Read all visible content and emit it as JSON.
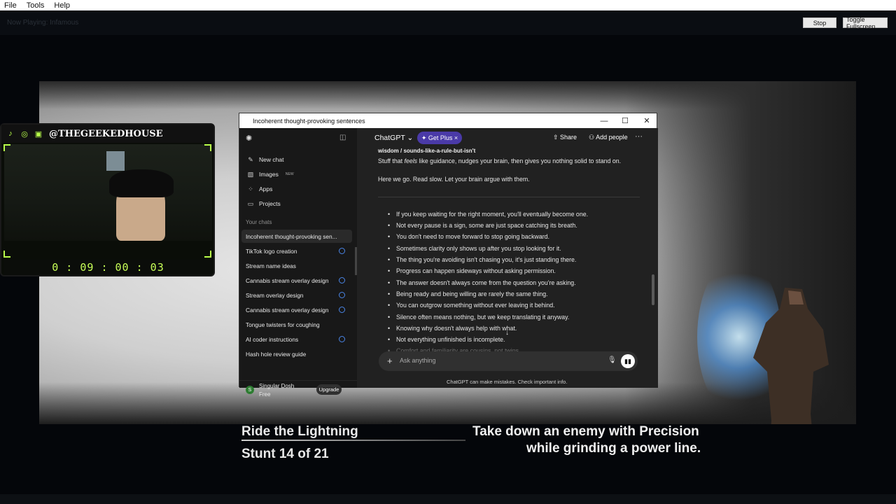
{
  "menubar": {
    "items": [
      "File",
      "Tools",
      "Help"
    ]
  },
  "toolbar": {
    "ghost_text": "Now Playing: Infamous",
    "stop_label": "Stop",
    "fullscreen_label": "Toggle Fullscreen"
  },
  "webcam": {
    "handle": "@THEGEEKEDHOUSE",
    "timer": "0 : 09 : 00 : 03",
    "icons": [
      "tiktok-icon",
      "instagram-icon",
      "twitch-icon"
    ]
  },
  "chatgpt": {
    "window_title": "Incoherent thought-provoking sentences",
    "sidebar": {
      "new_chat": "New chat",
      "images": "Images",
      "images_badge": "NEW",
      "apps": "Apps",
      "projects": "Projects",
      "your_chats": "Your chats",
      "chats": [
        "Incoherent thought-provoking sen...",
        "TikTok logo creation",
        "Stream name ideas",
        "Cannabis stream overlay design",
        "Stream overlay design",
        "Cannabis stream overlay design",
        "Tongue twisters for coughing",
        "AI coder instructions",
        "Hash hole review guide"
      ],
      "account_name": "Singular Dosh",
      "account_plan": "Free",
      "upgrade": "Upgrade",
      "avatar_initial": "S"
    },
    "header": {
      "model": "ChatGPT ⌄",
      "get_plus": "✦ Get Plus ×",
      "share": "Share",
      "add_people": "Add people"
    },
    "content": {
      "heading_partial": "wisdom / sounds-like-a-rule-but-isn't",
      "line1_pre": "Stuff that ",
      "line1_em": "feels",
      "line1_post": " like guidance, nudges your brain, then gives you nothing solid to stand on.",
      "line2": "Here we go. Read slow. Let your brain argue with them.",
      "bullets": [
        "If you keep waiting for the right moment, you'll eventually become one.",
        "Not every pause is a sign, some are just space catching its breath.",
        "You don't need to move forward to stop going backward.",
        "Sometimes clarity only shows up after you stop looking for it.",
        "The thing you're avoiding isn't chasing you, it's just standing there.",
        "Progress can happen sideways without asking permission.",
        "The answer doesn't always come from the question you're asking.",
        "Being ready and being willing are rarely the same thing.",
        "You can outgrow something without ever leaving it behind.",
        "Silence often means nothing, but we keep translating it anyway.",
        "Knowing why doesn't always help with what.",
        "Not everything unfinished is incomplete.",
        "Comfort and familiarity are cousins, not twins."
      ]
    },
    "composer": {
      "placeholder": "Ask anything"
    },
    "disclaimer": "ChatGPT can make mistakes. Check important info."
  },
  "captions": {
    "challenge_title": "Ride the Lightning",
    "stunt_progress": "Stunt 14 of 21",
    "objective_line1": "Take down an enemy with Precision",
    "objective_line2": "while grinding a power line."
  }
}
